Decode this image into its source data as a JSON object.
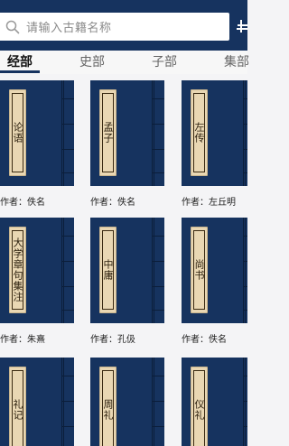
{
  "search": {
    "placeholder": "请输入古籍名称"
  },
  "tabs": [
    {
      "label": "经部",
      "active": true
    },
    {
      "label": "史部",
      "active": false
    },
    {
      "label": "子部",
      "active": false
    },
    {
      "label": "集部",
      "active": false
    }
  ],
  "books": [
    {
      "title": "论语",
      "author": "作者：佚名"
    },
    {
      "title": "孟子",
      "author": "作者：佚名"
    },
    {
      "title": "左传",
      "author": "作者：左丘明"
    },
    {
      "title": "大学章句集注",
      "author": "作者：朱熹"
    },
    {
      "title": "中庸",
      "author": "作者：孔伋"
    },
    {
      "title": "尚书",
      "author": "作者：佚名"
    },
    {
      "title": "礼记",
      "author": ""
    },
    {
      "title": "周礼",
      "author": ""
    },
    {
      "title": "仪礼",
      "author": ""
    }
  ],
  "colors": {
    "navy": "#16335f",
    "label": "#e9d7b3"
  },
  "icons": {
    "search": "search-icon",
    "corner": "menu-icon"
  }
}
